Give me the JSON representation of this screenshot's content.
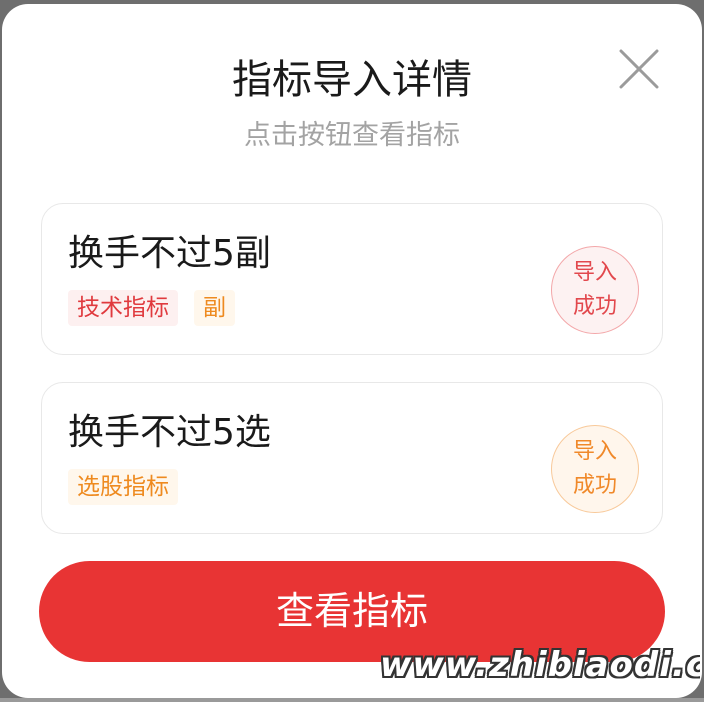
{
  "dialog": {
    "title": "指标导入详情",
    "subtitle": "点击按钮查看指标",
    "close_icon": "close-icon"
  },
  "items": [
    {
      "name": "换手不过5副",
      "tags": [
        "技术指标",
        "副"
      ],
      "status_line1": "导入",
      "status_line2": "成功"
    },
    {
      "name": "换手不过5选",
      "tags": [
        "选股指标"
      ],
      "status_line1": "导入",
      "status_line2": "成功"
    }
  ],
  "primary_button": {
    "label": "查看指标"
  },
  "watermark": "www.zhibiaodi.com",
  "colors": {
    "primary": "#e83434",
    "tag_red": "#e03a3e",
    "tag_orange": "#ee8a1f"
  }
}
